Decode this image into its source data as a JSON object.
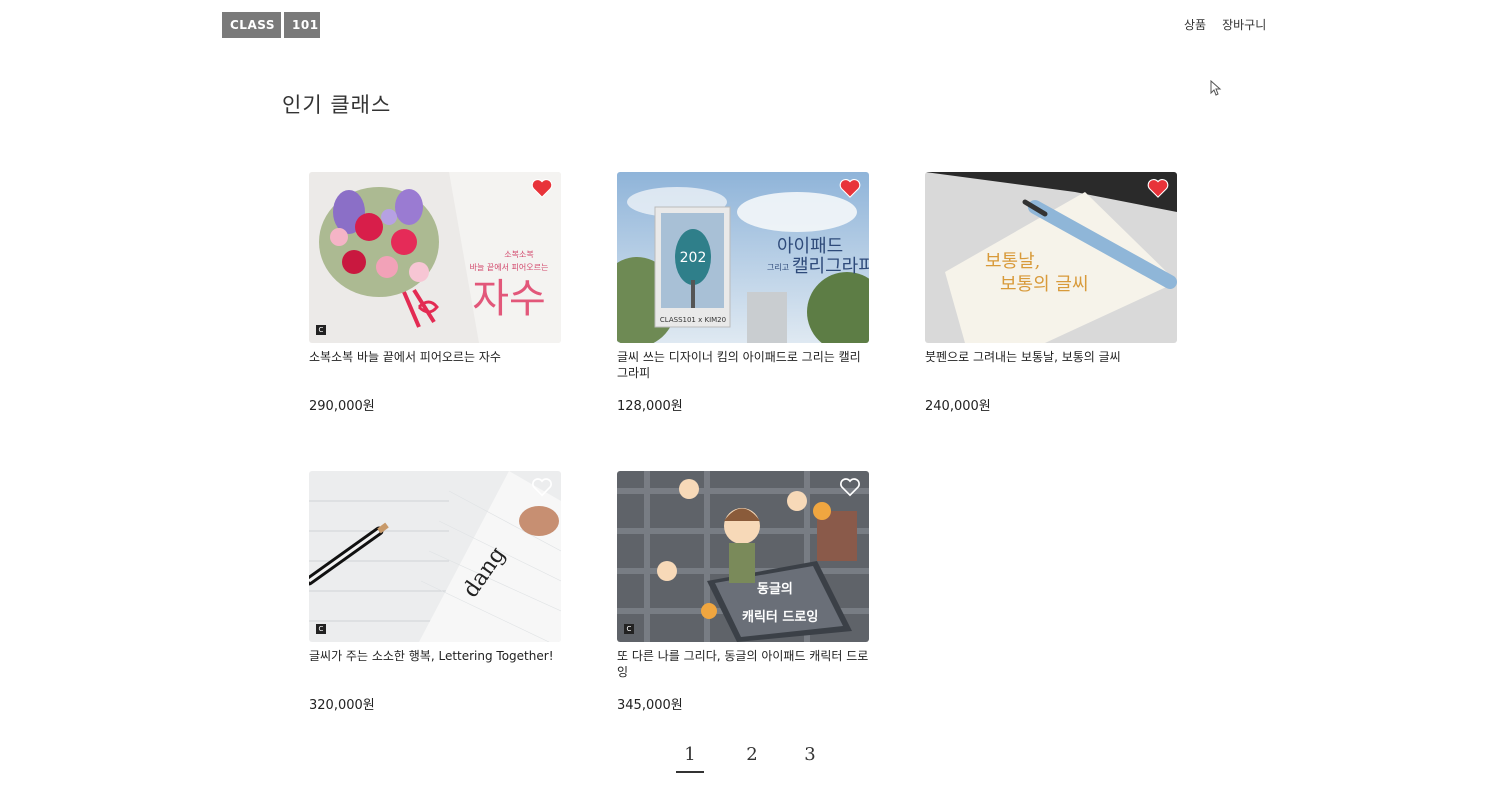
{
  "header": {
    "logo_left": "CLASS",
    "logo_right": "101",
    "nav": [
      "상품",
      "장바구니"
    ]
  },
  "section_title": "인기 클래스",
  "cards": [
    {
      "title": "소복소복 바늘 끝에서 피어오르는 자수",
      "price": "290,000원",
      "liked": true,
      "badge": "C",
      "thumb_text_small": "소복소복\n바늘 끝에서 피어오르는",
      "thumb_text_big": "자수"
    },
    {
      "title": "글씨 쓰는 디자이너 킴의 아이패드로 그리는 캘리그라피",
      "price": "128,000원",
      "liked": true,
      "badge": "",
      "thumb_text_small": "그리고",
      "thumb_text_big": "아이패드 캘리그라피",
      "thumb_sign": "202",
      "thumb_caption": "CLASS101 x KIM20"
    },
    {
      "title": "붓펜으로 그려내는 보통날, 보통의 글씨",
      "price": "240,000원",
      "liked": true,
      "badge": "",
      "thumb_text_big": "보통날, 보통의 글씨"
    },
    {
      "title": "글씨가 주는 소소한 행복, Lettering Together!",
      "price": "320,000원",
      "liked": false,
      "badge": "C",
      "thumb_text_big": "dang"
    },
    {
      "title": "또 다른 나를 그리다, 동글의 아이패드 캐릭터 드로잉",
      "price": "345,000원",
      "liked": false,
      "badge": "C",
      "thumb_text_big": "동글의\n캐릭터 드로잉"
    }
  ],
  "pagination": {
    "pages": [
      "1",
      "2",
      "3"
    ],
    "current": "1"
  },
  "colors": {
    "heart_red": "#e8333a",
    "logo_gray": "#7a7a7a"
  }
}
